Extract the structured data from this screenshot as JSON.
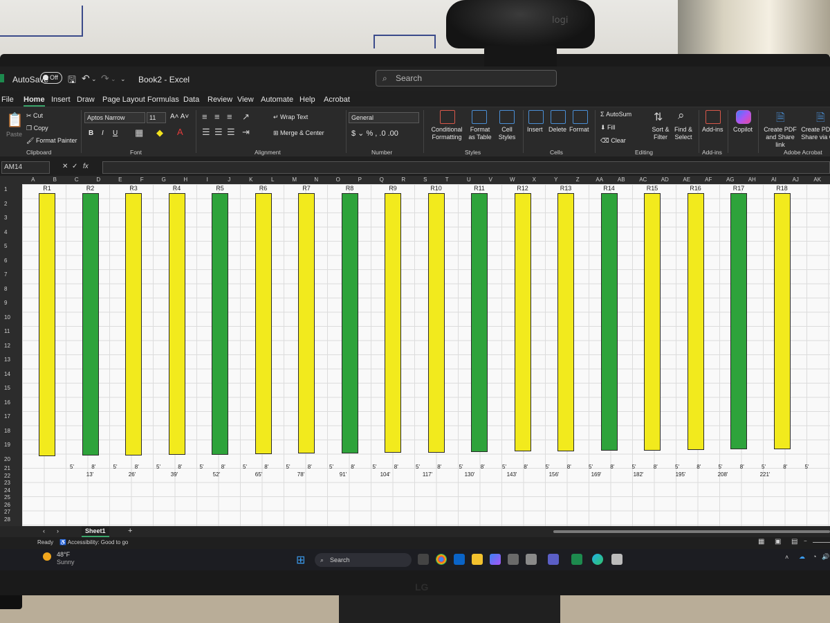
{
  "titlebar": {
    "autosave_label": "AutoSave",
    "autosave_state": "Off",
    "document": "Book2 - Excel",
    "search_placeholder": "Search"
  },
  "menu_tabs": [
    "File",
    "Home",
    "Insert",
    "Draw",
    "Page Layout",
    "Formulas",
    "Data",
    "Review",
    "View",
    "Automate",
    "Help",
    "Acrobat"
  ],
  "active_tab": "Home",
  "ribbon": {
    "clipboard": {
      "paste": "Paste",
      "cut": "Cut",
      "copy": "Copy",
      "format_painter": "Format Painter",
      "label": "Clipboard"
    },
    "font": {
      "name": "Aptos Narrow",
      "size": "11",
      "label": "Font"
    },
    "alignment": {
      "wrap": "Wrap Text",
      "merge": "Merge & Center",
      "label": "Alignment"
    },
    "number": {
      "format": "General",
      "label": "Number"
    },
    "styles": {
      "conditional": "Conditional Formatting",
      "format_table": "Format as Table",
      "cell_styles": "Cell Styles",
      "label": "Styles"
    },
    "cells": {
      "insert": "Insert",
      "delete": "Delete",
      "format": "Format",
      "label": "Cells"
    },
    "editing": {
      "autosum": "AutoSum",
      "fill": "Fill",
      "clear": "Clear",
      "sort": "Sort & Filter",
      "find": "Find & Select",
      "label": "Editing"
    },
    "addins": {
      "addins": "Add-ins",
      "label": "Add-ins"
    },
    "copilot": "Copilot",
    "acrobat": {
      "create_pdf": "Create PDF and Share link",
      "create_pdf2": "Create PDF Share via O",
      "label": "Adobe Acrobat"
    }
  },
  "formula_bar": {
    "name_box": "AM14",
    "fx": "fx"
  },
  "columns": [
    "A",
    "B",
    "C",
    "D",
    "E",
    "F",
    "G",
    "H",
    "I",
    "J",
    "K",
    "L",
    "M",
    "N",
    "O",
    "P",
    "Q",
    "R",
    "S",
    "T",
    "U",
    "V",
    "W",
    "X",
    "Y",
    "Z",
    "AA",
    "AB",
    "AC",
    "AD",
    "AE",
    "AF",
    "AG",
    "AH",
    "AI",
    "AJ",
    "AK"
  ],
  "rows": [
    "1",
    "2",
    "3",
    "4",
    "5",
    "6",
    "7",
    "8",
    "9",
    "10",
    "11",
    "12",
    "13",
    "14",
    "15",
    "16",
    "17",
    "18",
    "19",
    "20",
    "21",
    "22",
    "23",
    "24",
    "25",
    "26",
    "27",
    "28"
  ],
  "racks": [
    {
      "label": "R1",
      "color": "#f2ea1d"
    },
    {
      "label": "R2",
      "color": "#2ea33b"
    },
    {
      "label": "R3",
      "color": "#f2ea1d"
    },
    {
      "label": "R4",
      "color": "#f2ea1d"
    },
    {
      "label": "R5",
      "color": "#2ea33b"
    },
    {
      "label": "R6",
      "color": "#f2ea1d"
    },
    {
      "label": "R7",
      "color": "#f2ea1d"
    },
    {
      "label": "R8",
      "color": "#2ea33b"
    },
    {
      "label": "R9",
      "color": "#f2ea1d"
    },
    {
      "label": "R10",
      "color": "#f2ea1d"
    },
    {
      "label": "R11",
      "color": "#2ea33b"
    },
    {
      "label": "R12",
      "color": "#f2ea1d"
    },
    {
      "label": "R13",
      "color": "#f2ea1d"
    },
    {
      "label": "R14",
      "color": "#2ea33b"
    },
    {
      "label": "R15",
      "color": "#f2ea1d"
    },
    {
      "label": "R16",
      "color": "#f2ea1d"
    },
    {
      "label": "R17",
      "color": "#2ea33b"
    },
    {
      "label": "R18",
      "color": "#f2ea1d"
    }
  ],
  "row22_values": [
    "5'",
    "8'",
    "5'",
    "8'",
    "5'",
    "8'",
    "5'",
    "8'",
    "5'",
    "8'",
    "5'",
    "8'",
    "5'",
    "8'",
    "5'",
    "8'",
    "5'",
    "8'",
    "5'",
    "8'",
    "5'",
    "8'",
    "5'",
    "8'",
    "5'",
    "8'",
    "5'",
    "8'",
    "5'",
    "8'",
    "5'",
    "8'",
    "5'",
    "8'",
    "5'"
  ],
  "row23_values": [
    "13'",
    "26'",
    "39'",
    "52'",
    "65'",
    "78'",
    "91'",
    "104'",
    "117'",
    "130'",
    "143'",
    "156'",
    "169'",
    "182'",
    "195'",
    "208'",
    "221'"
  ],
  "sheet_tab": "Sheet1",
  "status": {
    "ready": "Ready",
    "accessibility": "Accessibility: Good to go"
  },
  "weather": {
    "temp": "48°F",
    "condition": "Sunny"
  },
  "taskbar_search": "Search"
}
